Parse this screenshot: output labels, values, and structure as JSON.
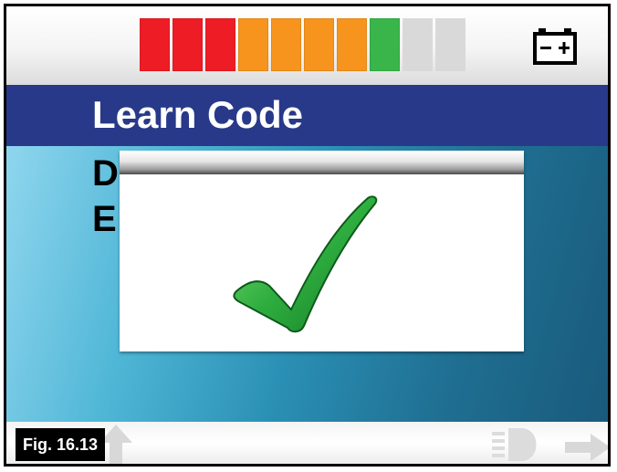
{
  "status_bar": {
    "battery_segments": [
      {
        "color": "#ee1c25",
        "on": true
      },
      {
        "color": "#ee1c25",
        "on": true
      },
      {
        "color": "#ee1c25",
        "on": true
      },
      {
        "color": "#f7941d",
        "on": true
      },
      {
        "color": "#f7941d",
        "on": true
      },
      {
        "color": "#f7941d",
        "on": true
      },
      {
        "color": "#f7941d",
        "on": true
      },
      {
        "color": "#39b54a",
        "on": true
      },
      {
        "color": "#d9d9d9",
        "on": false
      },
      {
        "color": "#d9d9d9",
        "on": false
      }
    ],
    "battery_level": 0.8,
    "battery_icon": "battery-icon"
  },
  "header": {
    "title": "Learn Code"
  },
  "menu": {
    "items": [
      "D",
      "E"
    ]
  },
  "dialog": {
    "icon": "checkmark-icon"
  },
  "bottom_nav": {
    "icons": [
      "arrow-left-icon",
      "arrow-up-icon",
      "headlight-icon",
      "arrow-right-icon"
    ]
  },
  "figure_label": "Fig. 16.13",
  "colors": {
    "title_band": "#28398a",
    "check_green": "#2fae3f"
  }
}
